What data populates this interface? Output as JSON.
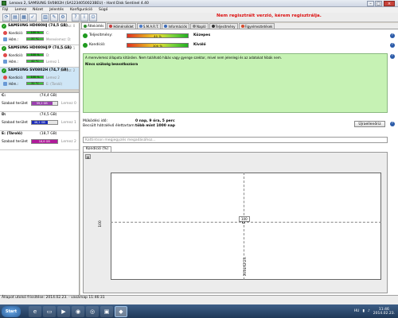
{
  "window": {
    "title": "Lenovo 2, SAMSUNG SV0802H (SA1234050023BEU) - Hard Disk Sentinel 4.40"
  },
  "menu": [
    "Fájl",
    "Lemez",
    "Nézet",
    "Jelentés",
    "Konfiguráció",
    "Súgó"
  ],
  "unregistered_notice": "Nem regisztrált verzió, kérem regisztrálja.",
  "disks": [
    {
      "title": "SAMSUNG HD080HJ (74,5 GB)",
      "disk_no": "Lemez: 0",
      "perf_label": "Kondíció:",
      "perf_value": "100 %",
      "perf_extra": "C:",
      "temp_label": "Hőm.:",
      "temp_value": "37 °C",
      "temp_extra": "Merevlemez: D:"
    },
    {
      "title": "SAMSUNG HD080HJ/P (74,5 GB)",
      "disk_no": "Lemez: 1",
      "perf_label": "Kondíció:",
      "perf_value": "100 %",
      "perf_extra": "D:",
      "temp_label": "Hőm.:",
      "temp_value": "42 °C",
      "temp_extra": "Lemez 1"
    },
    {
      "title": "SAMSUNG SV0802H (74,7 GB)",
      "disk_no": "Lemez: 2",
      "perf_label": "Kondíció:",
      "perf_value": "100 %",
      "perf_extra": "Lemez 2",
      "temp_label": "Hőm.:",
      "temp_value": "32 °C",
      "temp_extra": "E: (Tároló)"
    }
  ],
  "volumes": [
    {
      "name": "C:",
      "size": "(74,4 GB)",
      "free_label": "Szabad terület",
      "free_value": "59,2 GB",
      "free_fraction": 0.8,
      "disk": "Lemez 0",
      "color": "#9b3fb0"
    },
    {
      "name": "D:",
      "size": "(74,5 GB)",
      "free_label": "Szabad terület",
      "free_value": "46,2 GB",
      "free_fraction": 0.62,
      "disk": "Lemez 1",
      "color": "#1a2ab8"
    },
    {
      "name": "E: (Tároló)",
      "size": "(18,7 GB)",
      "free_label": "Szabad terület",
      "free_value": "18,6 GB",
      "free_fraction": 0.99,
      "disk": "Lemez 2",
      "color": "#b01a9a"
    }
  ],
  "tabs": [
    "Áttekintés",
    "Hőmérséklet",
    "S.M.A.R.T.",
    "Információk",
    "Napló",
    "Teljesítmény",
    "Figyelmeztetések"
  ],
  "summary": {
    "perf_label": "Teljesítmény:",
    "perf_value": "40 %",
    "perf_word": "Közepes",
    "health_label": "Kondíció:",
    "health_value": "100 %",
    "health_word": "Kiváló",
    "message": "A merevlemez állapota kitűnően. Nem található hibás vagy gyenge szektor, mivel nem jelenlegi és az adatokat hibák nem.",
    "no_action": "Nincs szükség beavatkozásra",
    "uptime_label": "Működési idő:",
    "uptime_value": "0 nap, 9 óra, 5 perc",
    "lifetime_label": "Becsült hátralévő élettartam:",
    "lifetime_value": "több mint 1000 nap",
    "settings_button": "Újraellenőriz",
    "comment_placeholder": "Kattintson megjegyzés megadásához...",
    "inner_tab": "Kondíció (%)"
  },
  "chart_data": {
    "type": "scatter",
    "x": [
      "2014.02.23."
    ],
    "values": [
      100
    ],
    "ylabel": "100",
    "point_label": "100"
  },
  "statusbar": "Állapot utolsó frissítése: 2014.02.23. - vasárnap 11:46:31",
  "taskbar": {
    "start": "Start",
    "tray_lang": "HU",
    "clock_time": "11:46",
    "clock_date": "2014.02.23."
  }
}
